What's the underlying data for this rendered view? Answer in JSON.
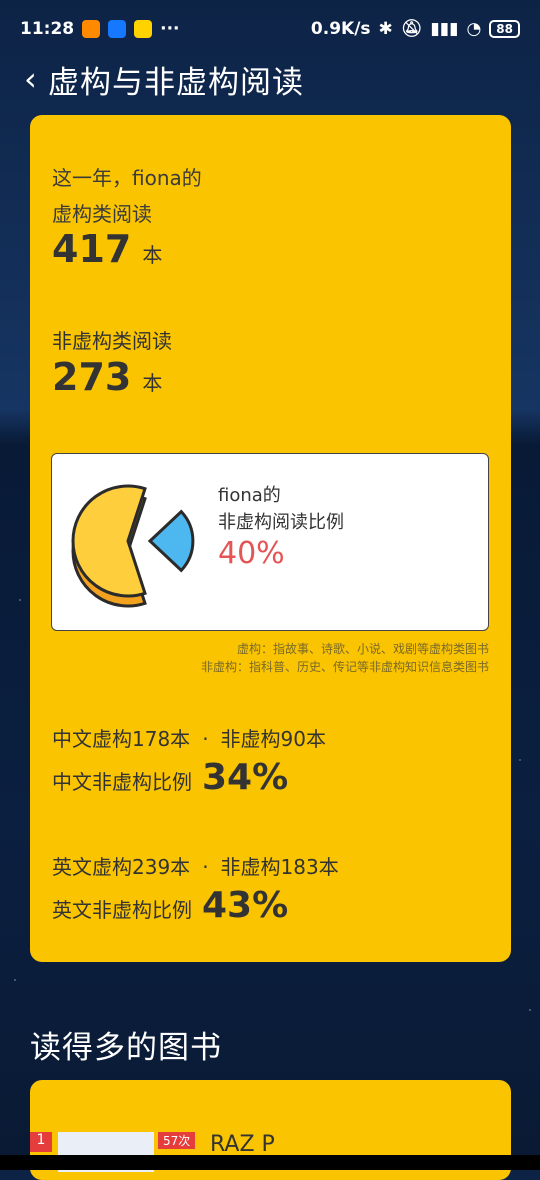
{
  "status": {
    "time": "11:28",
    "dots": "···",
    "speed": "0.9K/s",
    "battery": "88",
    "app_colors": [
      "#ff8a00",
      "#1677ff",
      "#ffd200"
    ]
  },
  "header": {
    "back_icon": "chevron-left-icon",
    "title": "虚构与非虚构阅读"
  },
  "card": {
    "intro_line1": "这一年，fiona的",
    "fiction_label": "虚构类阅读",
    "fiction_count": "417",
    "unit": "本",
    "nonfiction_label": "非虚构类阅读",
    "nonfiction_count": "273",
    "ratio": {
      "line1": "fiona的",
      "line2": "非虚构阅读比例",
      "value": "40%",
      "fraction": 0.4
    },
    "note1": "虚构：指故事、诗歌、小说、戏剧等虚构类图书",
    "note2": "非虚构：指科普、历史、传记等非虚构知识信息类图书",
    "chinese": {
      "fiction": "中文虚构178本",
      "dot": "·",
      "nonfiction": "非虚构90本",
      "ratio_label": "中文非虚构比例",
      "ratio_value": "34%"
    },
    "english": {
      "fiction": "英文虚构239本",
      "dot": "·",
      "nonfiction": "非虚构183本",
      "ratio_label": "英文非虚构比例",
      "ratio_value": "43%"
    }
  },
  "section2": {
    "title": "读得多的图书",
    "first_book": {
      "rank": "1",
      "count": "57次",
      "title": "RAZ P"
    }
  },
  "colors": {
    "card": "#fbc400",
    "accent": "#e45555",
    "pie_main": "#ffce3d",
    "pie_slice": "#4db8f0"
  }
}
